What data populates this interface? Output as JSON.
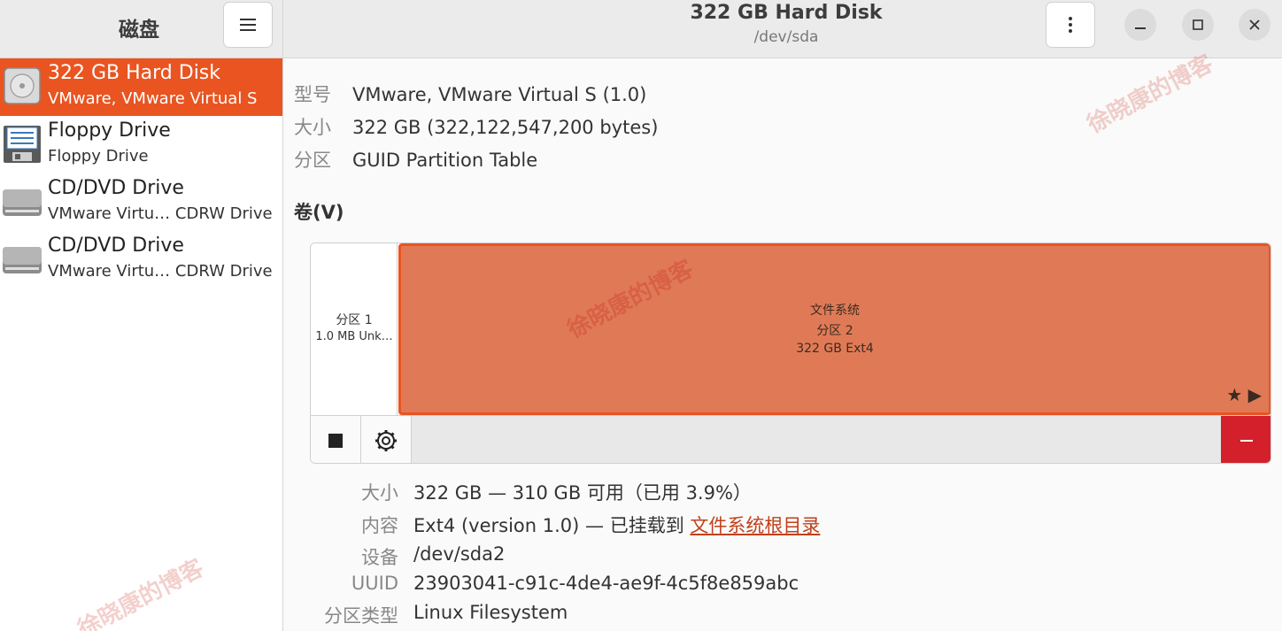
{
  "app": {
    "title": "磁盘"
  },
  "header": {
    "title": "322 GB Hard Disk",
    "subtitle": "/dev/sda"
  },
  "sidebar": {
    "items": [
      {
        "line1": "322 GB Hard Disk",
        "line2": "VMware, VMware Virtual S",
        "icon": "hard-disk-icon",
        "selected": true
      },
      {
        "line1": "Floppy Drive",
        "line2": "Floppy Drive",
        "icon": "floppy-icon",
        "selected": false
      },
      {
        "line1": "CD/DVD Drive",
        "line2": "VMware Virtu… CDRW Drive",
        "icon": "optical-drive-icon",
        "selected": false
      },
      {
        "line1": "CD/DVD Drive",
        "line2": "VMware Virtu… CDRW Drive",
        "icon": "optical-drive-icon",
        "selected": false
      }
    ]
  },
  "disk_info": {
    "model_label": "型号",
    "model_value": "VMware, VMware Virtual S (1.0)",
    "size_label": "大小",
    "size_value": "322 GB (322,122,547,200 bytes)",
    "partitioning_label": "分区",
    "partitioning_value": "GUID Partition Table"
  },
  "volumes": {
    "title": "卷(V)",
    "partition1": {
      "name": "分区 1",
      "desc": "1.0 MB Unk…"
    },
    "partition2": {
      "type": "文件系统",
      "name": "分区 2",
      "desc": "322 GB Ext4"
    },
    "badges": "★ ▶"
  },
  "details": {
    "size_label": "大小",
    "size_value": "322 GB — 310 GB 可用（已用 3.9%）",
    "content_label": "内容",
    "content_value": "Ext4 (version 1.0) — 已挂载到 ",
    "content_link": "文件系统根目录",
    "device_label": "设备",
    "device_value": "/dev/sda2",
    "uuid_label": "UUID",
    "uuid_value": "23903041-c91c-4de4-ae9f-4c5f8e859abc",
    "ptype_label": "分区类型",
    "ptype_value": "Linux Filesystem"
  },
  "watermark": "徐晓康的博客",
  "colors": {
    "accent": "#e95420",
    "partition_fill": "#e07a56",
    "destructive": "#d3202a"
  }
}
